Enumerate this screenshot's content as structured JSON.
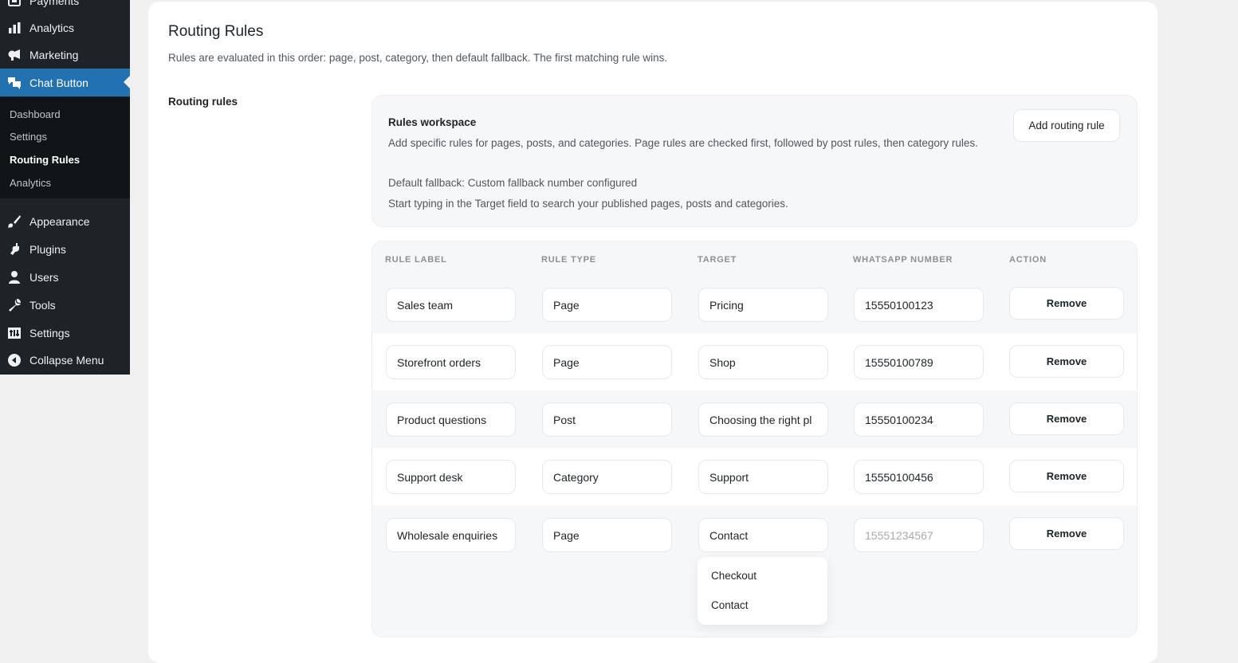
{
  "sidebar": {
    "items": [
      {
        "label": "Payments",
        "icon": "payments-icon"
      },
      {
        "label": "Analytics",
        "icon": "bar-chart-icon"
      },
      {
        "label": "Marketing",
        "icon": "megaphone-icon"
      },
      {
        "label": "Chat Button",
        "icon": "chat-bubbles-icon"
      },
      {
        "label": "Appearance",
        "icon": "paintbrush-icon"
      },
      {
        "label": "Plugins",
        "icon": "plug-icon"
      },
      {
        "label": "Users",
        "icon": "user-icon"
      },
      {
        "label": "Tools",
        "icon": "wrench-icon"
      },
      {
        "label": "Settings",
        "icon": "settings-sliders-icon"
      },
      {
        "label": "Collapse Menu",
        "icon": "collapse-icon"
      }
    ],
    "submenu": [
      "Dashboard",
      "Settings",
      "Routing Rules",
      "Analytics"
    ]
  },
  "page": {
    "title": "Routing Rules",
    "description": "Rules are evaluated in this order: page, post, category, then default fallback. The first matching rule wins.",
    "section_label": "Routing rules"
  },
  "workspace": {
    "title": "Rules workspace",
    "description": "Add specific rules for pages, posts, and categories. Page rules are checked first, followed by post rules, then category rules.",
    "fallback": "Default fallback: Custom fallback number configured",
    "hint": "Start typing in the Target field to search your published pages, posts and categories.",
    "add_button": "Add routing rule"
  },
  "table": {
    "headers": [
      "RULE LABEL",
      "RULE TYPE",
      "TARGET",
      "WHATSAPP NUMBER",
      "ACTION"
    ],
    "rows": [
      {
        "label": "Sales team",
        "type": "Page",
        "target": "Pricing",
        "number": "15550100123",
        "action": "Remove"
      },
      {
        "label": "Storefront orders",
        "type": "Page",
        "target": "Shop",
        "number": "15550100789",
        "action": "Remove"
      },
      {
        "label": "Product questions",
        "type": "Post",
        "target": "Choosing the right pl",
        "number": "15550100234",
        "action": "Remove"
      },
      {
        "label": "Support desk",
        "type": "Category",
        "target": "Support",
        "number": "15550100456",
        "action": "Remove"
      },
      {
        "label": "Wholesale enquiries",
        "type": "Page",
        "target": "Contact",
        "number_placeholder": "15551234567",
        "action": "Remove"
      }
    ]
  },
  "target_dropdown": {
    "options": [
      "Checkout",
      "Contact"
    ]
  },
  "colors": {
    "sidebar_bg": "#1d2327",
    "accent": "#2271b1"
  }
}
